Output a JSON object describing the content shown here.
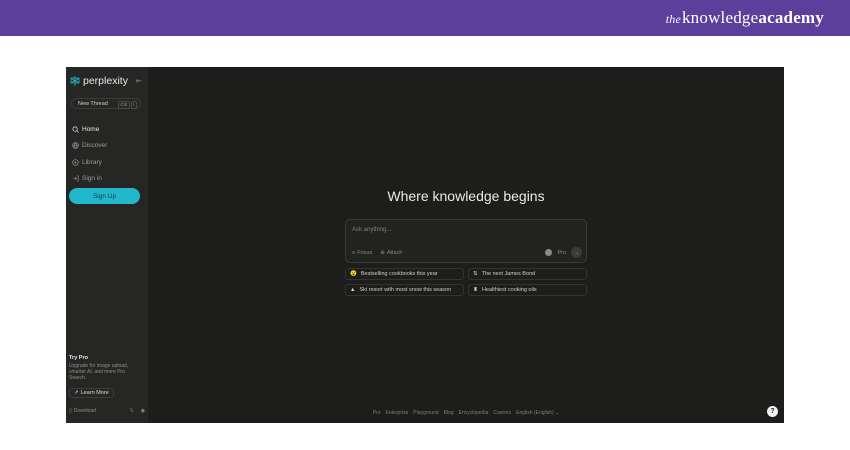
{
  "branding": {
    "the": "the",
    "knowledge": "knowledge",
    "academy": "academy"
  },
  "app": {
    "name": "perplexity",
    "accent_color": "#21b8cd",
    "collapse_icon": "collapse-icon",
    "new_thread": {
      "label": "New Thread",
      "shortcut": [
        "Ctrl",
        "I"
      ]
    },
    "nav": [
      {
        "label": "Home",
        "icon": "search-icon",
        "active": true
      },
      {
        "label": "Discover",
        "icon": "globe-icon",
        "active": false
      },
      {
        "label": "Library",
        "icon": "library-icon",
        "active": false
      },
      {
        "label": "Sign in",
        "icon": "sign-in-icon",
        "active": false
      }
    ],
    "signup_label": "Sign Up",
    "try_pro": {
      "title": "Try Pro",
      "description": "Upgrade for image upload, smarter AI, and more Pro Search.",
      "learn_more": "Learn More"
    },
    "sidebar_footer": {
      "download": "Download"
    }
  },
  "main": {
    "headline": "Where knowledge begins",
    "search": {
      "placeholder": "Ask anything...",
      "focus_label": "Focus",
      "attach_label": "Attach",
      "pro_label": "Pro"
    },
    "suggestions": [
      {
        "icon": "😮",
        "label": "Bestselling cookbooks this year"
      },
      {
        "icon": "⇅",
        "label": "The next James Bond"
      },
      {
        "icon": "▲",
        "label": "Ski resort with most snow this season"
      },
      {
        "icon": "♜",
        "label": "Healthiest cooking oils"
      }
    ],
    "footer_links": [
      "Pro",
      "Enterprise",
      "Playground",
      "Blog",
      "Encyclopedia",
      "Careers",
      "English (English) ⌄"
    ],
    "help_label": "?"
  }
}
